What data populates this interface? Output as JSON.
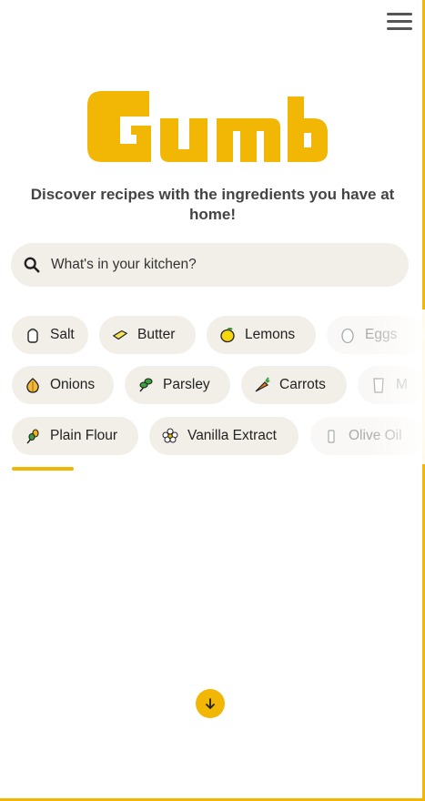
{
  "header": {
    "menu_icon": "hamburger-menu-icon"
  },
  "brand": {
    "logo_text": "Gumbo",
    "logo_color": "#F2B705"
  },
  "tagline": "Discover recipes with the ingredients you have at home!",
  "search": {
    "placeholder": "What's in your kitchen?",
    "value": "",
    "icon": "search-icon"
  },
  "ingredients": {
    "row1": [
      {
        "label": "Salt",
        "icon": "salt-shaker-icon"
      },
      {
        "label": "Butter",
        "icon": "butter-icon"
      },
      {
        "label": "Lemons",
        "icon": "lemon-icon"
      },
      {
        "label": "Eggs",
        "icon": "egg-icon"
      }
    ],
    "row2": [
      {
        "label": "Onions",
        "icon": "onion-icon"
      },
      {
        "label": "Parsley",
        "icon": "parsley-icon"
      },
      {
        "label": "Carrots",
        "icon": "carrot-icon"
      },
      {
        "label": "M",
        "icon": "milk-icon"
      }
    ],
    "row3": [
      {
        "label": "Plain Flour",
        "icon": "wheat-icon"
      },
      {
        "label": "Vanilla Extract",
        "icon": "vanilla-flower-icon"
      },
      {
        "label": "Olive Oil",
        "icon": "olive-oil-icon"
      }
    ]
  },
  "scroll_down_icon": "arrow-down-icon",
  "colors": {
    "accent": "#F2B705",
    "chip_bg": "#F2EFE9",
    "text": "#222222"
  }
}
